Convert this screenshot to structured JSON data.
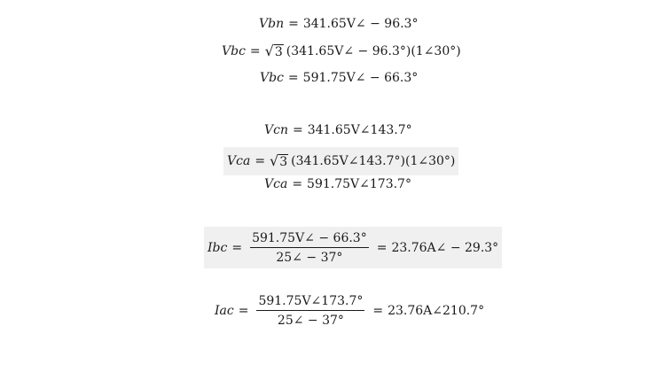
{
  "equations": {
    "vbn": {
      "lhs": "Vbn",
      "eq": "=",
      "rhs": "341.65V∠ − 96.3°"
    },
    "vbc1": {
      "lhs": "Vbc",
      "eq": "=",
      "root_arg": "3",
      "rhs": "(341.65V∠ − 96.3°)(1∠30°)"
    },
    "vbc2": {
      "lhs": "Vbc",
      "eq": "=",
      "rhs": "591.75V∠ − 66.3°"
    },
    "vcn": {
      "lhs": "Vcn",
      "eq": "=",
      "rhs": "341.65V∠143.7°"
    },
    "vca1": {
      "lhs": "Vca",
      "eq": "=",
      "root_arg": "3",
      "rhs": "(341.65V∠143.7°)(1∠30°)"
    },
    "vca2": {
      "lhs": "Vca",
      "eq": "=",
      "rhs": "591.75V∠173.7°"
    },
    "ibc": {
      "lhs": "Ibc",
      "eq": "=",
      "num": "591.75V∠ − 66.3°",
      "den": "25∠ − 37°",
      "eq2": "=",
      "result": "23.76A∠ − 29.3°"
    },
    "iac": {
      "lhs": "Iac",
      "eq": "=",
      "num": "591.75V∠173.7°",
      "den": "25∠ − 37°",
      "eq2": "=",
      "result": "23.76A∠210.7°"
    }
  }
}
